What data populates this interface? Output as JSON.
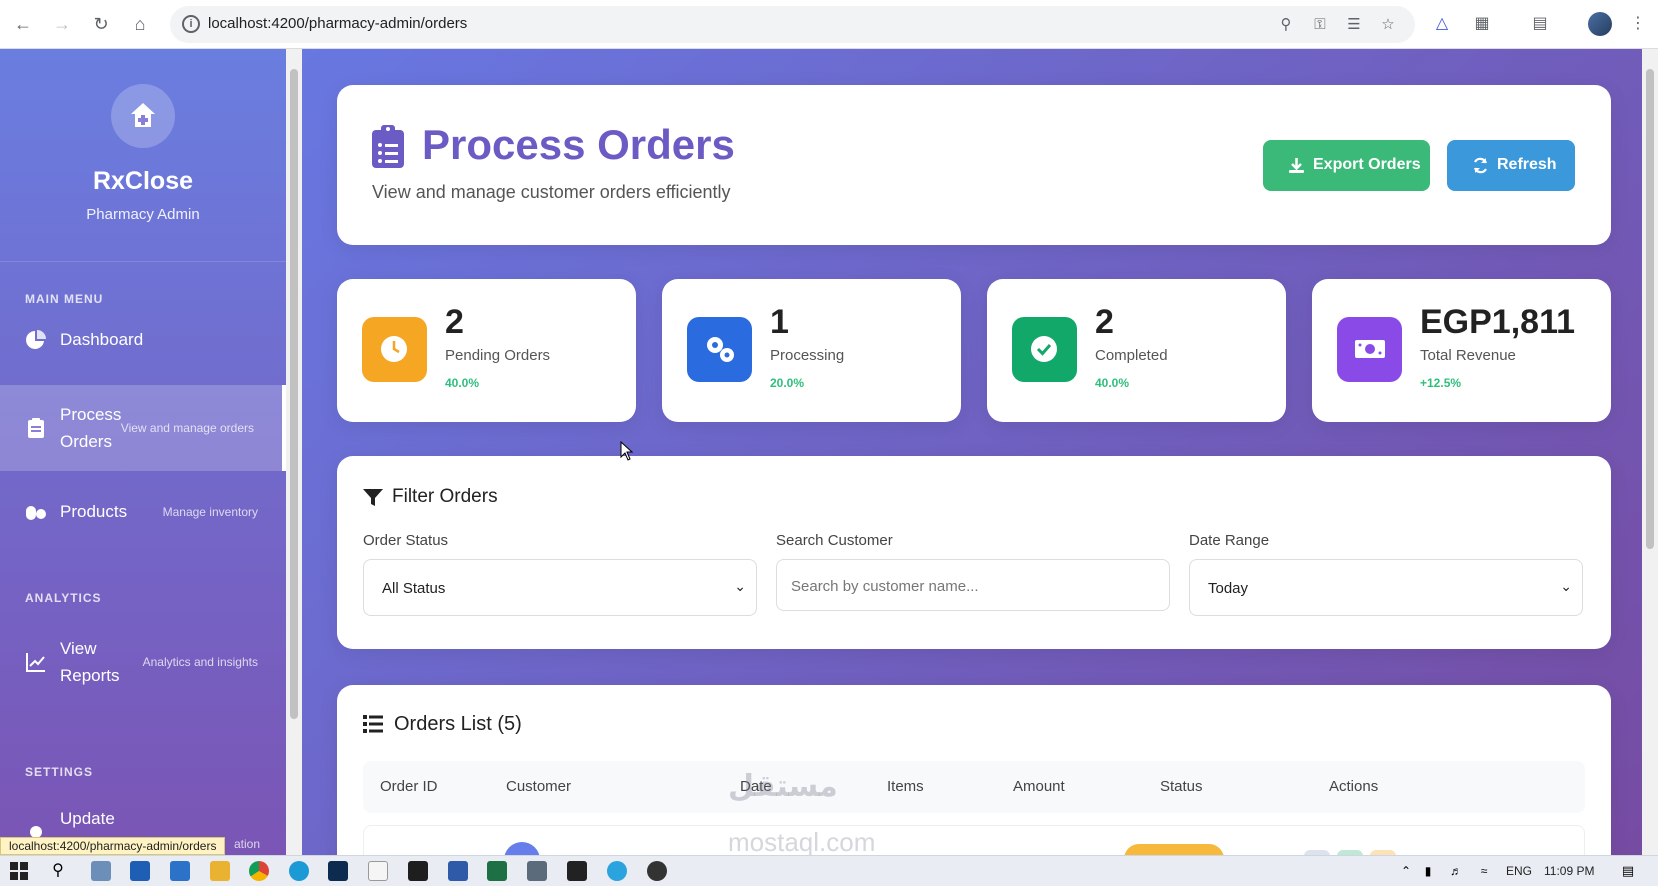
{
  "browser": {
    "url": "localhost:4200/pharmacy-admin/orders",
    "status_url": "localhost:4200/pharmacy-admin/orders"
  },
  "sidebar": {
    "brand": "RxClose",
    "subtitle": "Pharmacy Admin",
    "sections": {
      "main": "MAIN MENU",
      "analytics": "ANALYTICS",
      "settings": "SETTINGS"
    },
    "items": [
      {
        "label": "Dashboard",
        "desc": ""
      },
      {
        "label": "Process Orders",
        "desc": "View and manage orders"
      },
      {
        "label": "Products",
        "desc": "Manage inventory"
      },
      {
        "label": "View Reports",
        "desc": "Analytics and insights"
      },
      {
        "label": "Update",
        "desc": "ation"
      }
    ]
  },
  "header": {
    "title": "Process Orders",
    "subtitle": "View and manage customer orders efficiently",
    "export_label": "Export Orders",
    "refresh_label": "Refresh"
  },
  "stats": [
    {
      "value": "2",
      "label": "Pending Orders",
      "pct": "40.0%",
      "color": "#f5a623"
    },
    {
      "value": "1",
      "label": "Processing",
      "pct": "20.0%",
      "color": "#2b6be0"
    },
    {
      "value": "2",
      "label": "Completed",
      "pct": "40.0%",
      "color": "#12a86a"
    },
    {
      "value": "EGP1,811",
      "label": "Total Revenue",
      "pct": "+12.5%",
      "color": "#8a4ae8"
    }
  ],
  "filters": {
    "title": "Filter Orders",
    "status_label": "Order Status",
    "status_value": "All Status",
    "search_label": "Search Customer",
    "search_placeholder": "Search by customer name...",
    "date_label": "Date Range",
    "date_value": "Today"
  },
  "orders": {
    "title": "Orders List (5)",
    "columns": [
      "Order ID",
      "Customer",
      "Date",
      "Items",
      "Amount",
      "Status",
      "Actions"
    ]
  },
  "taskbar": {
    "lang": "ENG",
    "time": "11:09 PM"
  },
  "watermark": {
    "arabic": "مستقل",
    "latin": "mostaql.com"
  }
}
